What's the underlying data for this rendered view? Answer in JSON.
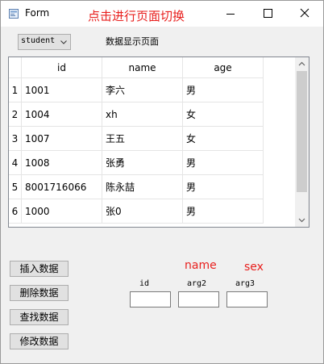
{
  "window": {
    "title": "Form",
    "annotation": "点击进行页面切换",
    "icon": "qt-form-icon",
    "controls": [
      "minimize-icon",
      "maximize-icon",
      "close-icon"
    ]
  },
  "page_select": {
    "value": "student",
    "icon": "chevron-down-icon"
  },
  "page_label": "数据显示页面",
  "table": {
    "columns": [
      "id",
      "name",
      "age"
    ],
    "row_numbers": [
      "1",
      "2",
      "3",
      "4",
      "5",
      "6"
    ],
    "rows": [
      [
        "1001",
        "李六",
        "男"
      ],
      [
        "1004",
        "xh",
        "女"
      ],
      [
        "1007",
        "王五",
        "女"
      ],
      [
        "1008",
        "张勇",
        "男"
      ],
      [
        "8001716066",
        "陈永喆",
        "男"
      ],
      [
        "1000",
        "张0",
        "男"
      ]
    ]
  },
  "buttons": {
    "insert": "插入数据",
    "delete": "删除数据",
    "query": "查找数据",
    "modify": "修改数据"
  },
  "annotations": {
    "name": "name",
    "sex": "sex"
  },
  "fields": {
    "id_label": "id",
    "arg2_label": "arg2",
    "arg3_label": "arg3",
    "id_value": "",
    "arg2_value": "",
    "arg3_value": ""
  },
  "colors": {
    "annotation_red": "#e8201e",
    "scrollbar_thumb": "#cdcdcd"
  }
}
